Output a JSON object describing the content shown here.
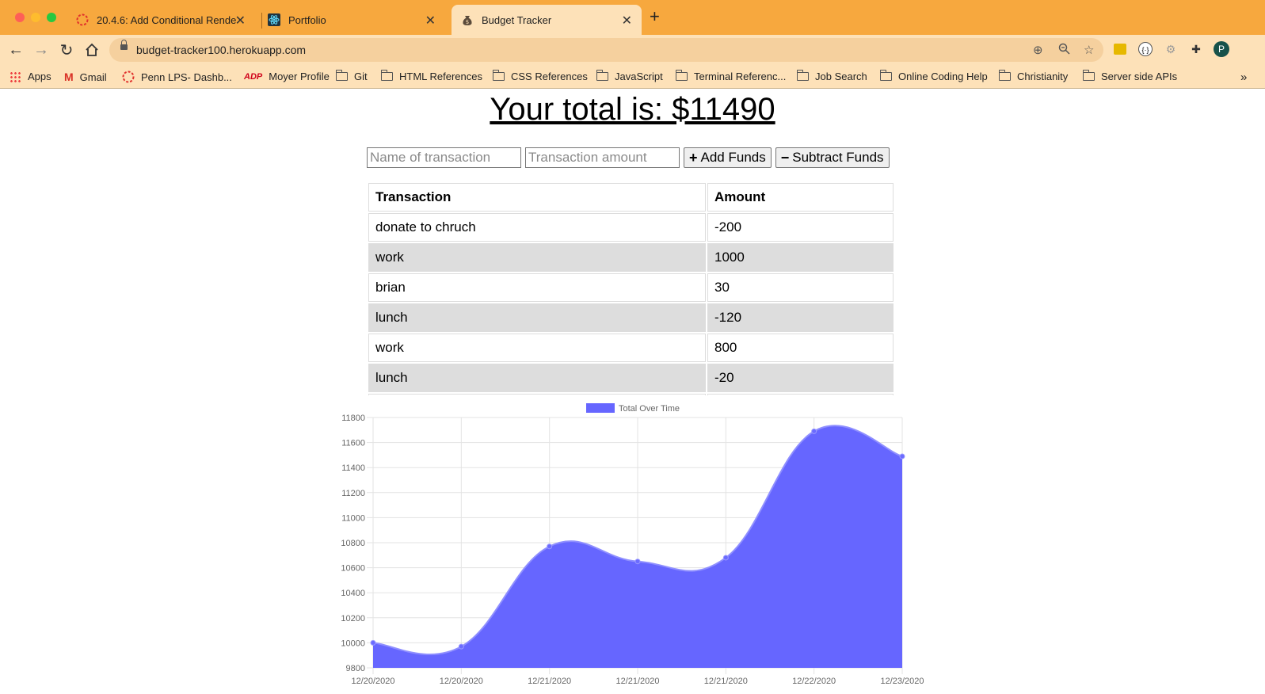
{
  "browser": {
    "tabs": [
      {
        "title": "20.4.6: Add Conditional Rende",
        "icon": "red-dashed-circle-icon"
      },
      {
        "title": "Portfolio",
        "icon": "react-icon"
      },
      {
        "title": "Budget Tracker",
        "icon": "money-bag-icon"
      }
    ],
    "url": "budget-tracker100.herokuapp.com",
    "profile_initial": "P",
    "bookmarks": [
      "Apps",
      "Gmail",
      "Penn LPS- Dashb...",
      "Moyer Profile",
      "Git",
      "HTML References",
      "CSS References",
      "JavaScript",
      "Terminal Referenc...",
      "Job Search",
      "Online Coding Help",
      "Christianity",
      "Server side APIs"
    ],
    "more": "»"
  },
  "page": {
    "total_label": "Your total is: $11490",
    "name_placeholder": "Name of transaction",
    "amount_placeholder": "Transaction amount",
    "add_label": "Add Funds",
    "subtract_label": "Subtract Funds",
    "table": {
      "headers": [
        "Transaction",
        "Amount"
      ],
      "rows": [
        [
          "donate to chruch",
          "-200"
        ],
        [
          "work",
          "1000"
        ],
        [
          "brian",
          "30"
        ],
        [
          "lunch",
          "-120"
        ],
        [
          "work",
          "800"
        ],
        [
          "lunch",
          "-20"
        ]
      ]
    }
  },
  "chart_data": {
    "type": "area",
    "legend": "Total Over Time",
    "legend_position": "top",
    "color": "#6666ff",
    "x": [
      "12/20/2020",
      "12/20/2020",
      "12/21/2020",
      "12/21/2020",
      "12/21/2020",
      "12/22/2020",
      "12/23/2020"
    ],
    "values": [
      10000,
      9970,
      10770,
      10650,
      10680,
      11690,
      11490
    ],
    "ylim": [
      9800,
      11800
    ],
    "yticks": [
      9800,
      10000,
      10200,
      10400,
      10600,
      10800,
      11000,
      11200,
      11400,
      11600,
      11800
    ],
    "grid": true
  }
}
